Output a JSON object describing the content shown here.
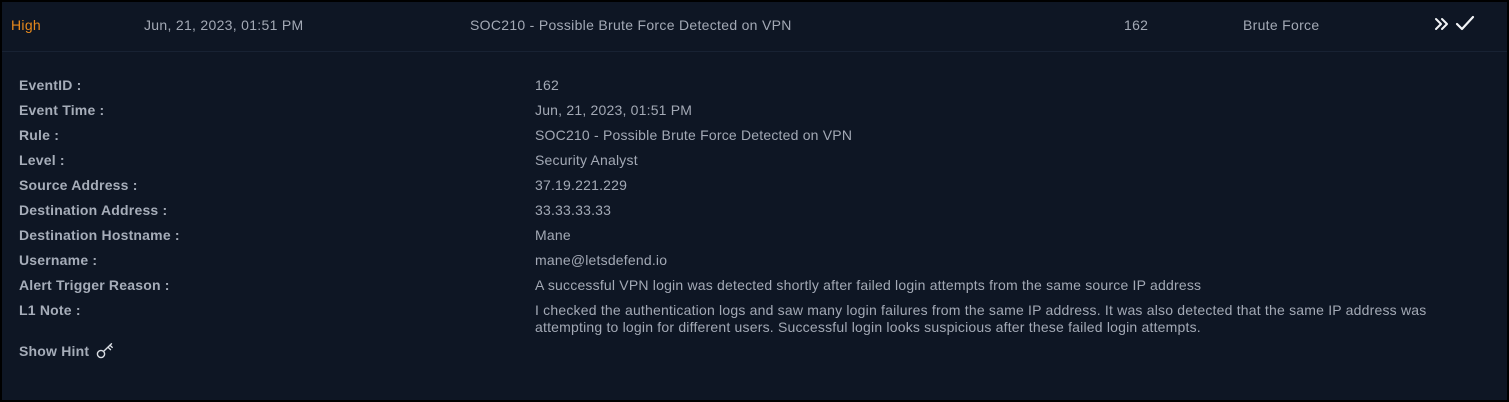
{
  "alert": {
    "level": "High",
    "time": "Jun, 21, 2023, 01:51 PM",
    "rule": "SOC210 - Possible Brute Force Detected on VPN",
    "event_id": "162",
    "type": "Brute Force"
  },
  "icons": {
    "expand": "double-chevron-right-icon",
    "check": "checkmark-icon",
    "hint": "key-icon"
  },
  "colors": {
    "background": "#0e1624",
    "level_high": "#e8891c",
    "text": "#a3a9b5"
  },
  "details": [
    {
      "label": "EventID :",
      "value": "162"
    },
    {
      "label": "Event Time :",
      "value": "Jun, 21, 2023, 01:51 PM"
    },
    {
      "label": "Rule :",
      "value": "SOC210 - Possible Brute Force Detected on VPN"
    },
    {
      "label": "Level :",
      "value": "Security Analyst"
    },
    {
      "label": "Source Address :",
      "value": "37.19.221.229"
    },
    {
      "label": "Destination Address :",
      "value": "33.33.33.33"
    },
    {
      "label": "Destination Hostname :",
      "value": "Mane"
    },
    {
      "label": "Username :",
      "value": "mane@letsdefend.io"
    },
    {
      "label": "Alert Trigger Reason :",
      "value": "A successful VPN login was detected shortly after failed login attempts from the same source IP address"
    },
    {
      "label": "L1 Note :",
      "value": "I checked the authentication logs and saw many login failures from the same IP address. It was also detected that the same IP address was attempting to login for different users. Successful login looks suspicious after these failed login attempts."
    }
  ],
  "hint": {
    "label": "Show Hint"
  }
}
